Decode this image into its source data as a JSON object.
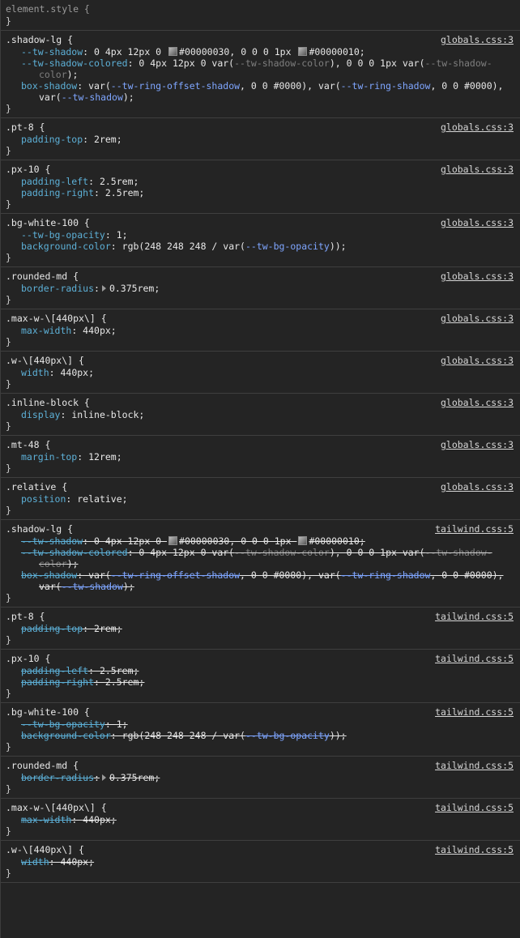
{
  "element_style": {
    "selector": "element.style {",
    "close": "}"
  },
  "globals": {
    "shadow": {
      "selector": ".shadow-lg {",
      "source": "globals.css:3",
      "l1_prop": "--tw-shadow",
      "l1_val_a": ": 0 4px 12px 0 ",
      "l1_color_a": "#00000030",
      "l1_val_b": ", 0 0 0 1px ",
      "l1_color_b": "#00000010",
      ";": ";",
      "l2_prop": "--tw-shadow-colored",
      "l2_val_a": ": 0 4px 12px 0 var(",
      "l2_var_a": "--tw-shadow-color",
      "l2_val_b": "), 0 0 0 1px var(",
      "l2_var_b": "--tw-shadow-color",
      "l2_end": ");",
      "l3_prop": "box-shadow",
      "l3_a": ": var(",
      "l3_v1": "--tw-ring-offset-shadow",
      "l3_b": ", 0 0 #0000), var(",
      "l3_v2": "--tw-ring-shadow",
      "l3_c": ", 0 0 #0000), var(",
      "l3_v3": "--tw-shadow",
      "l3_end": ");"
    },
    "pt8": {
      "selector": ".pt-8 {",
      "source": "globals.css:3",
      "prop": "padding-top",
      "val": "2rem"
    },
    "px10": {
      "selector": ".px-10 {",
      "source": "globals.css:3",
      "p1": "padding-left",
      "v1": "2.5rem",
      "p2": "padding-right",
      "v2": "2.5rem"
    },
    "bg": {
      "selector": ".bg-white-100 {",
      "source": "globals.css:3",
      "p1": "--tw-bg-opacity",
      "v1": "1",
      "p2": "background-color",
      "v2a": "rgb(248 248 248 / var(",
      "v2var": "--tw-bg-opacity",
      "v2b": "));"
    },
    "rounded": {
      "selector": ".rounded-md {",
      "source": "globals.css:3",
      "prop": "border-radius",
      "val": "0.375rem"
    },
    "maxw": {
      "selector": ".max-w-\\[440px\\] {",
      "source": "globals.css:3",
      "prop": "max-width",
      "val": "440px"
    },
    "w": {
      "selector": ".w-\\[440px\\] {",
      "source": "globals.css:3",
      "prop": "width",
      "val": "440px"
    },
    "inline": {
      "selector": ".inline-block {",
      "source": "globals.css:3",
      "prop": "display",
      "val": "inline-block"
    },
    "mt48": {
      "selector": ".mt-48 {",
      "source": "globals.css:3",
      "prop": "margin-top",
      "val": "12rem"
    },
    "relative": {
      "selector": ".relative {",
      "source": "globals.css:3",
      "prop": "position",
      "val": "relative"
    }
  },
  "tailwind": {
    "source": "tailwind.css:5",
    "shadow_selector": ".shadow-lg {",
    "pt8_selector": ".pt-8 {",
    "px10_selector": ".px-10 {",
    "bg_selector": ".bg-white-100 {",
    "rounded_selector": ".rounded-md {",
    "maxw_selector": ".max-w-\\[440px\\] {",
    "w_selector": ".w-\\[440px\\] {"
  },
  "close_brace": "}"
}
